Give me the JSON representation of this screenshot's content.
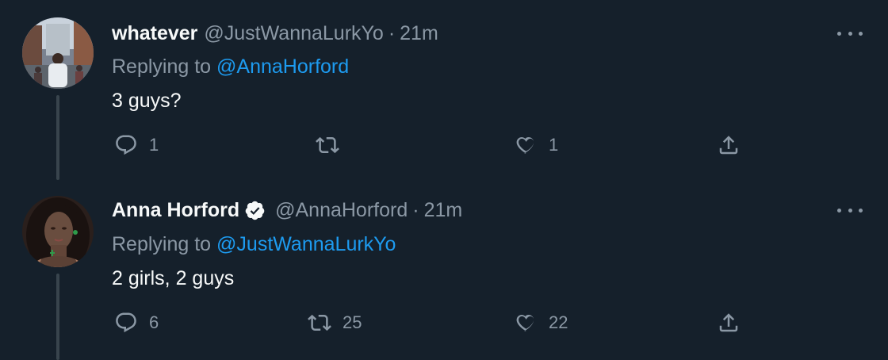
{
  "tweets": [
    {
      "name": "whatever",
      "handle": "@JustWannaLurkYo",
      "separator": "·",
      "time": "21m",
      "replying_prefix": "Replying to",
      "replying_to": "@AnnaHorford",
      "text": "3 guys?",
      "verified": false,
      "replies": "1",
      "retweets": "",
      "likes": "1"
    },
    {
      "name": "Anna Horford",
      "handle": "@AnnaHorford",
      "separator": "·",
      "time": "21m",
      "replying_prefix": "Replying to",
      "replying_to": "@JustWannaLurkYo",
      "text": "2 girls, 2 guys",
      "verified": true,
      "replies": "6",
      "retweets": "25",
      "likes": "22"
    }
  ],
  "colors": {
    "background": "#15202b",
    "text_primary": "#f7f9f9",
    "text_secondary": "#8b98a5",
    "accent": "#1d9bf0",
    "thread_line": "#38444d"
  },
  "icons": [
    "reply-icon",
    "retweet-icon",
    "like-icon",
    "share-icon",
    "more-icon",
    "verified-icon"
  ]
}
